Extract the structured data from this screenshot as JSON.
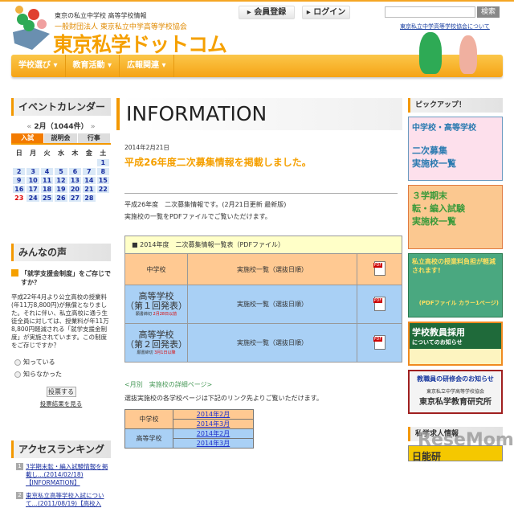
{
  "header": {
    "tagline": "東京の私立中学校 高等学校情報",
    "org": "一般財団法人 東京私立中学高等学校協会",
    "brand": "東京私学ドットコム",
    "register": "▸ 会員登録",
    "login": "▸ ログイン",
    "search_value": "",
    "search_button": "検索",
    "assoc_link": "東京私立中学高等学校協会について"
  },
  "nav": [
    "学校選び ▾",
    "教育活動 ▾",
    "広報関連 ▾"
  ],
  "calendar": {
    "title": "イベントカレンダー",
    "prev": "«",
    "next": "»",
    "month": "2月（1044件）",
    "tabs": [
      "入試",
      "説明会",
      "行事"
    ],
    "weekdays": [
      "日",
      "月",
      "火",
      "水",
      "木",
      "金",
      "土"
    ],
    "weeks": [
      [
        "",
        "",
        "",
        "",
        "",
        "",
        "1"
      ],
      [
        "2",
        "3",
        "4",
        "5",
        "6",
        "7",
        "8"
      ],
      [
        "9",
        "10",
        "11",
        "12",
        "13",
        "14",
        "15"
      ],
      [
        "16",
        "17",
        "18",
        "19",
        "20",
        "21",
        "22"
      ],
      [
        "23",
        "24",
        "25",
        "26",
        "27",
        "28",
        ""
      ]
    ]
  },
  "voice": {
    "title": "みんなの声",
    "question": "「就学支援金制度」をご存じですか？",
    "body": "平成22年4月より公立高校の授業料(年11万8,800円)が無償となりました。それに伴い、私立高校に通う生徒全員に対しては、授業料が年11万8,800円軽減される「就学支援金制度」が実施されています。この制度をご存じですか？",
    "options": [
      "知っている",
      "知らなかった"
    ],
    "vote": "投票する",
    "results": "投票結果を見る"
  },
  "ranking": {
    "title": "アクセスランキング",
    "items": [
      {
        "n": "1",
        "text": "3学期末転・編入試験情報を掲載し…(2014/02/18)【INFORMATION】"
      },
      {
        "n": "2",
        "text": "東京私立高等学校入試について…(2011/08/19)【高校入"
      }
    ]
  },
  "main": {
    "title": "INFORMATION",
    "date": "2014年2月21日",
    "headline": "平成26年度二次募集情報を掲載しました。",
    "line1": "平成26年度　二次募集情報です。(2月21日更新 最新版)",
    "line2": "実施校の一覧をPDFファイルでご覧いただけます。",
    "table_caption": "■ 2014年度　二次募集情報一覧表（PDFファイル）",
    "rows": [
      {
        "school": "中学校",
        "list": "実施校一覧（選抜日順）"
      },
      {
        "school": "高等学校",
        "sub": "（第１回発表）",
        "note": "願書締切",
        "note_link": "2月28日以前",
        "list": "実施校一覧（選抜日順）"
      },
      {
        "school": "高等学校",
        "sub": "（第２回発表）",
        "note": "願書締切",
        "note_link": "3月1日以降",
        "list": "実施校一覧（選抜日順）"
      }
    ],
    "section": "<月別　実施校の詳細ページ>",
    "section_text": "選抜実施校の各学校ページは下記のリンク先よりご覧いただけます。",
    "monthly": {
      "jh": "中学校",
      "hs": "高等学校",
      "links": [
        "2014年2月",
        "2014年3月",
        "2014年2月",
        "2014年3月"
      ]
    }
  },
  "pickup": {
    "title": "ピックアップ！",
    "banners": [
      "中学校・高等学校",
      "二次募集\n実施校一覧",
      "３学期末\n転・編入試験\n実施校一覧",
      "私立高校の授業料負担が軽減されます!",
      "(PDFファイル カラー1ページ)",
      "学校教員採用",
      "についてのお知らせ",
      "教職員の研修会のお知らせ",
      "東京私立中学高等学校協会",
      "東京私学教育研究所"
    ],
    "next_title": "私学求人情報",
    "next_banner": "日能研"
  },
  "watermark": "ReseMom"
}
